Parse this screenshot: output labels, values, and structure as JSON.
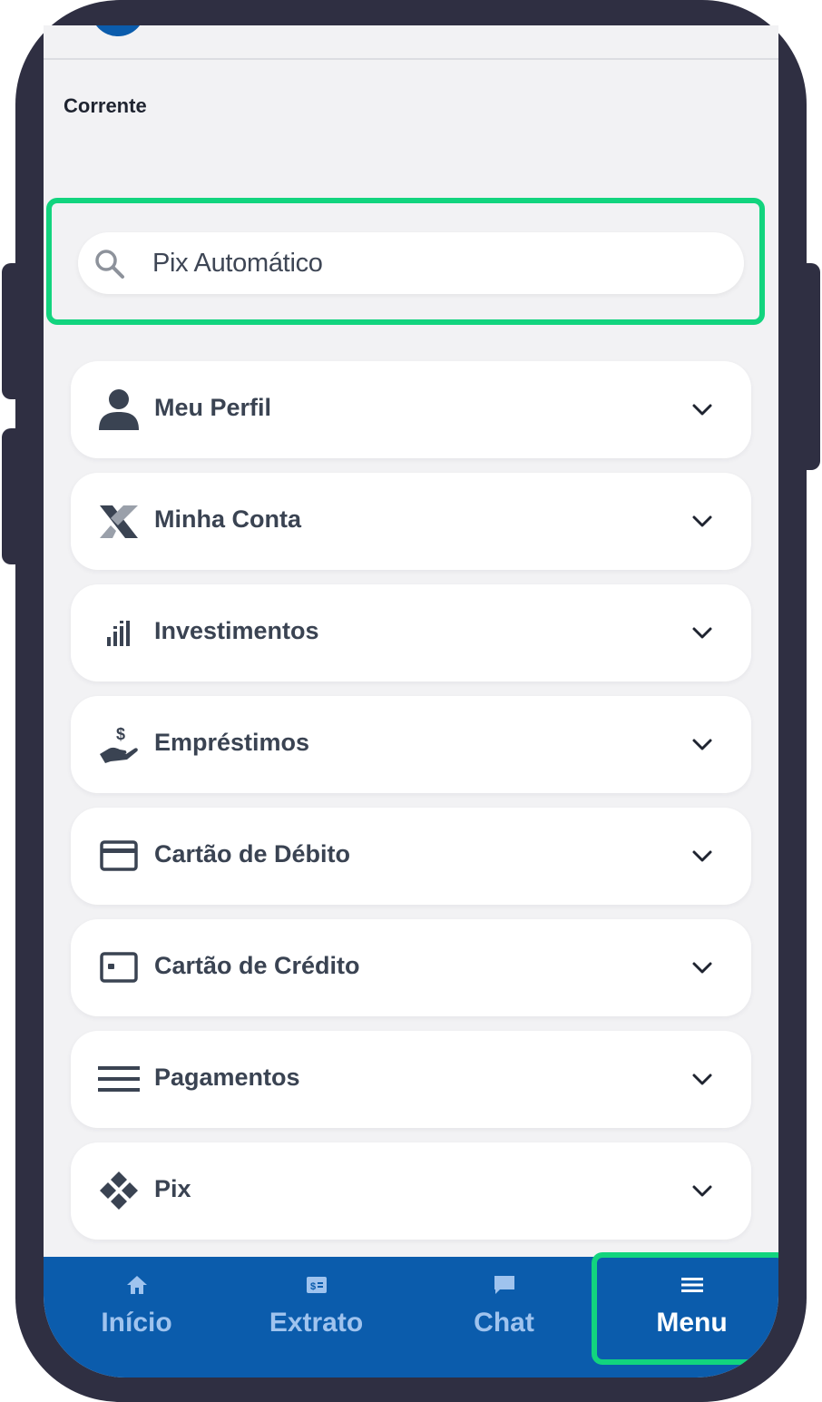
{
  "header": {
    "account_label": "Corrente"
  },
  "search": {
    "value": "Pix Automático"
  },
  "menu": {
    "items": [
      {
        "label": "Meu Perfil",
        "icon": "person-icon"
      },
      {
        "label": "Minha Conta",
        "icon": "caixa-logo-icon"
      },
      {
        "label": "Investimentos",
        "icon": "bar-chart-icon"
      },
      {
        "label": "Empréstimos",
        "icon": "hand-money-icon"
      },
      {
        "label": "Cartão de Débito",
        "icon": "credit-card-icon"
      },
      {
        "label": "Cartão de Crédito",
        "icon": "card-chip-icon"
      },
      {
        "label": "Pagamentos",
        "icon": "lines-icon"
      },
      {
        "label": "Pix",
        "icon": "pix-icon"
      }
    ]
  },
  "bottom_nav": {
    "items": [
      {
        "label": "Início",
        "icon": "home-icon"
      },
      {
        "label": "Extrato",
        "icon": "statement-icon"
      },
      {
        "label": "Chat",
        "icon": "chat-icon"
      },
      {
        "label": "Menu",
        "icon": "menu-icon",
        "active": true
      }
    ]
  },
  "colors": {
    "primary_blue": "#0b5cac",
    "highlight_green": "#12d47e",
    "phone_frame": "#2f2f42",
    "text_dark": "#3a4352"
  }
}
